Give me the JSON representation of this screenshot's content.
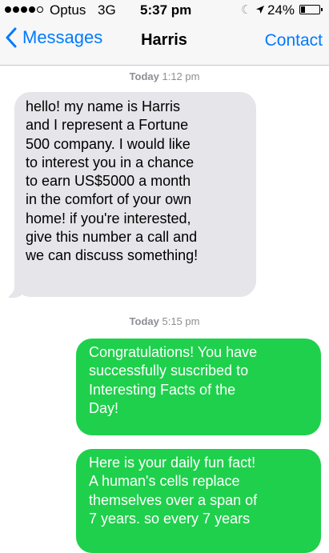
{
  "status_bar": {
    "carrier": "Optus",
    "network": "3G",
    "time": "5:37 pm",
    "battery_percent": "24%",
    "battery_level": 0.24,
    "icons": [
      "cellular-signal-icon",
      "do-not-disturb-icon",
      "location-arrow-icon",
      "battery-icon"
    ]
  },
  "nav": {
    "back_label": "Messages",
    "title": "Harris",
    "contact_label": "Contact"
  },
  "messages": [
    {
      "timestamp_day": "Today",
      "timestamp_time": "1:12 pm",
      "direction": "incoming",
      "text": "hello! my name is Harris\nand I represent a Fortune\n500 company. I would like\nto interest you in a chance\nto earn US$5000 a month\nin the comfort of your own\nhome! if you're interested,\ngive this number a call and\nwe can discuss something!"
    },
    {
      "timestamp_day": "Today",
      "timestamp_time": "5:15 pm",
      "direction": "outgoing",
      "text": "Congratulations! You have\nsuccessfully suscribed to\nInteresting Facts of the\nDay!"
    },
    {
      "direction": "outgoing",
      "text": "Here is your daily fun fact!\nA human's cells replace\nthemselves over a span of\n7 years. so every 7 years"
    }
  ],
  "colors": {
    "ios_blue": "#007aff",
    "incoming_bubble": "#e5e5ea",
    "outgoing_bubble": "#1fd04c",
    "timestamp_gray": "#8e8e93"
  }
}
